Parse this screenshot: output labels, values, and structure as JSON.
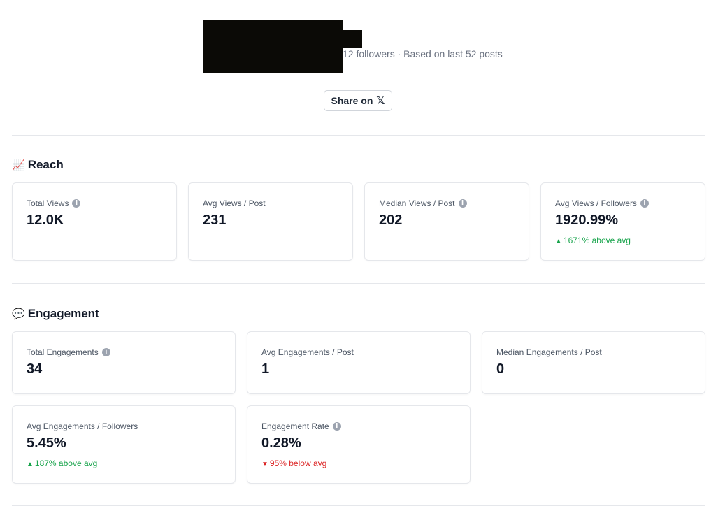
{
  "profile": {
    "meta": "12 followers · Based on last 52 posts",
    "share_label": "Share on",
    "share_icon": "x-logo-icon"
  },
  "reach": {
    "icon": "📈",
    "title": "Reach",
    "cards": [
      {
        "label": "Total Views",
        "value": "12.0K",
        "info": true
      },
      {
        "label": "Avg Views / Post",
        "value": "231",
        "info": false
      },
      {
        "label": "Median Views / Post",
        "value": "202",
        "info": true
      },
      {
        "label": "Avg Views / Followers",
        "value": "1920.99%",
        "info": true,
        "trend": "1671% above avg",
        "trend_dir": "up"
      }
    ]
  },
  "engagement": {
    "icon": "💬",
    "title": "Engagement",
    "cards": [
      {
        "label": "Total Engagements",
        "value": "34",
        "info": true
      },
      {
        "label": "Avg Engagements / Post",
        "value": "1",
        "info": false
      },
      {
        "label": "Median Engagements / Post",
        "value": "0",
        "info": false
      },
      {
        "label": "Avg Engagements / Followers",
        "value": "5.45%",
        "info": false,
        "trend": "187% above avg",
        "trend_dir": "up"
      },
      {
        "label": "Engagement Rate",
        "value": "0.28%",
        "info": true,
        "trend": "95% below avg",
        "trend_dir": "down"
      }
    ]
  },
  "colors": {
    "trend_up": "#16a34a",
    "trend_down": "#dc2626"
  }
}
